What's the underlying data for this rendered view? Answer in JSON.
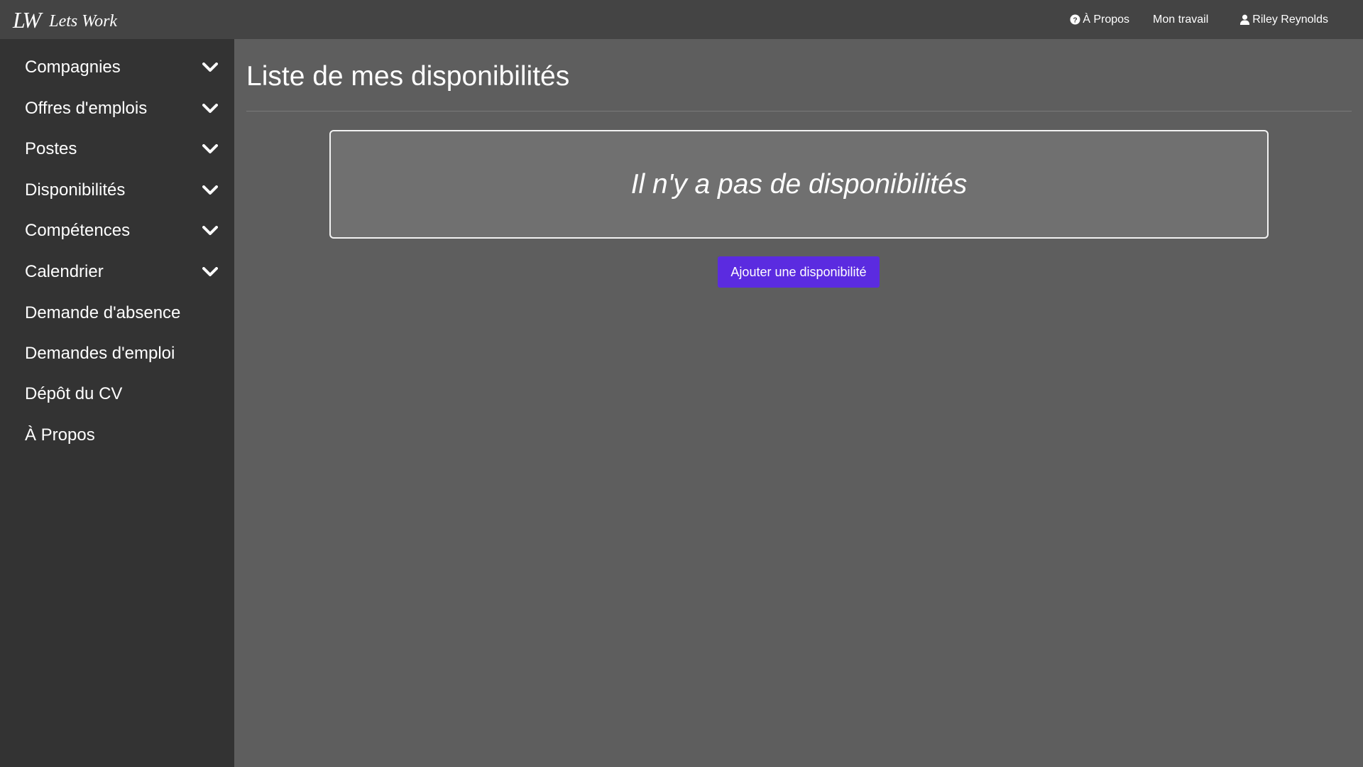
{
  "header": {
    "logo_mark": "LW",
    "app_name": "Lets Work",
    "nav": {
      "about": {
        "label": "À Propos",
        "icon": "question-circle-icon"
      },
      "work": {
        "label": "Mon travail"
      },
      "user": {
        "label": "Riley Reynolds",
        "icon": "user-icon"
      }
    }
  },
  "sidebar": {
    "items": [
      {
        "label": "Compagnies",
        "expandable": true
      },
      {
        "label": "Offres d'emplois",
        "expandable": true
      },
      {
        "label": "Postes",
        "expandable": true
      },
      {
        "label": "Disponibilités",
        "expandable": true
      },
      {
        "label": "Compétences",
        "expandable": true
      },
      {
        "label": "Calendrier",
        "expandable": true
      },
      {
        "label": "Demande d'absence",
        "expandable": false
      },
      {
        "label": "Demandes d'emploi",
        "expandable": false
      },
      {
        "label": "Dépôt du CV",
        "expandable": false
      },
      {
        "label": "À Propos",
        "expandable": false
      }
    ]
  },
  "main": {
    "title": "Liste de mes disponibilités",
    "empty_message": "Il n'y a pas de disponibilités",
    "add_button_label": "Ajouter une disponibilité"
  },
  "colors": {
    "topbar_bg": "#444444",
    "sidebar_bg": "#333333",
    "content_bg": "#5e5e5e",
    "empty_box_bg": "#707070",
    "button_bg": "#5b2be0"
  }
}
